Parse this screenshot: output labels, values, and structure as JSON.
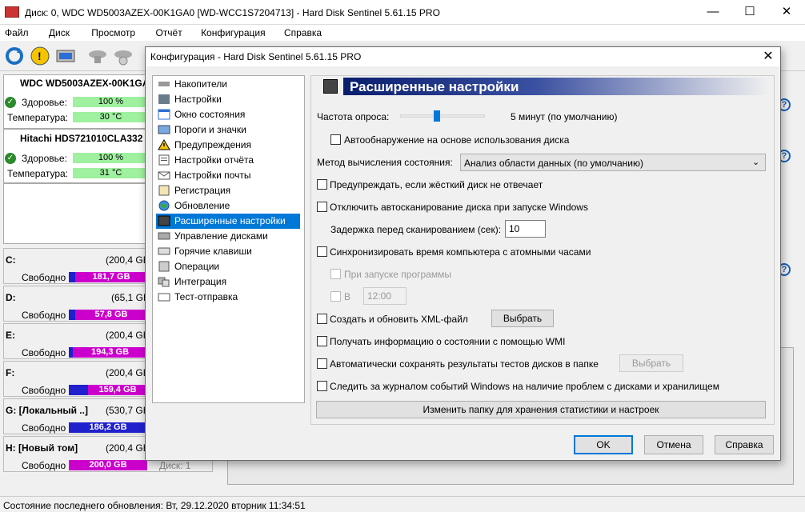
{
  "window": {
    "title": "Диск: 0, WDC WD5003AZEX-00K1GA0 [WD-WCC1S7204713]  -  Hard Disk Sentinel 5.61.15 PRO"
  },
  "controls": {
    "minimize": "—",
    "maximize": "☐",
    "close": "✕"
  },
  "menu": [
    "Файл",
    "Диск",
    "Просмотр",
    "Отчёт",
    "Конфигурация",
    "Справка"
  ],
  "disks": [
    {
      "name": "WDC WD5003AZEX-00K1GA",
      "health_label": "Здоровье:",
      "health": "100 %",
      "temp_label": "Температура:",
      "temp": "30 °C"
    },
    {
      "name": "Hitachi HDS721010CLA332",
      "health_label": "Здоровье:",
      "health": "100 %",
      "temp_label": "Температура:",
      "temp": "31 °C"
    }
  ],
  "volumes": [
    {
      "letter": "C:",
      "size": "(200,4 GB",
      "free_label": "Свободно",
      "free": "181,7 GB",
      "color": "#cc00cc"
    },
    {
      "letter": "D:",
      "size": "(65,1 GB",
      "free_label": "Свободно",
      "free": "57,8 GB",
      "color": "#cc00cc"
    },
    {
      "letter": "E:",
      "size": "(200,4 GB",
      "free_label": "Свободно",
      "free": "194,3 GB",
      "color": "#cc00cc"
    },
    {
      "letter": "F:",
      "size": "(200,4 GB",
      "free_label": "Свободно",
      "free": "159,4 GB",
      "color": "#cc00cc"
    },
    {
      "letter": "G: [Локальный ..]",
      "size": "(530,7 GB",
      "free_label": "Свободно",
      "free": "186,2 GB",
      "color": "#2020cc"
    },
    {
      "letter": "H: [Новый том]",
      "size": "(200,4 GB",
      "free_label": "Свободно",
      "free": "200,0 GB",
      "color": "#cc00cc"
    }
  ],
  "partial_text": "Диск: 1",
  "status": "Состояние последнего обновления: Вт, 29.12.2020 вторник 11:34:51",
  "dialog": {
    "title": "Конфигурация  -  Hard Disk Sentinel 5.61.15 PRO",
    "nav": [
      "Накопители",
      "Настройки",
      "Окно состояния",
      "Пороги и значки",
      "Предупреждения",
      "Настройки отчёта",
      "Настройки почты",
      "Регистрация",
      "Обновление",
      "Расширенные настройки",
      "Управление дисками",
      "Горячие клавиши",
      "Операции",
      "Интеграция",
      "Тест-отправка"
    ],
    "nav_selected": 9,
    "header": "Расширенные настройки",
    "poll_label": "Частота опроса:",
    "poll_value": "5 минут (по умолчанию)",
    "poll_slider": 0.4,
    "autodetect": "Автообнаружение на основе использования диска",
    "method_label": "Метод вычисления состояния:",
    "method_value": "Анализ области данных (по умолчанию)",
    "warn_noresp": "Предупреждать, если жёсткий диск не отвечает",
    "disable_autoscan": "Отключить автосканирование диска при запуске Windows",
    "delay_label": "Задержка перед сканированием (сек):",
    "delay_value": "10",
    "sync_time": "Синхронизировать время компьютера с атомными часами",
    "on_start": "При запуске программы",
    "at_label": "В",
    "at_value": "12:00",
    "xml": "Создать и обновить XML-файл",
    "choose1": "Выбрать",
    "wmi": "Получать информацию о состоянии с помощью WMI",
    "autosave": "Автоматически сохранять результаты тестов дисков в папке",
    "choose2": "Выбрать",
    "eventlog": "Следить за журналом событий Windows на наличие проблем с дисками и хранилищем",
    "change_folder": "Изменить папку для хранения статистики и настроек",
    "ok": "OK",
    "cancel": "Отмена",
    "help": "Справка"
  }
}
